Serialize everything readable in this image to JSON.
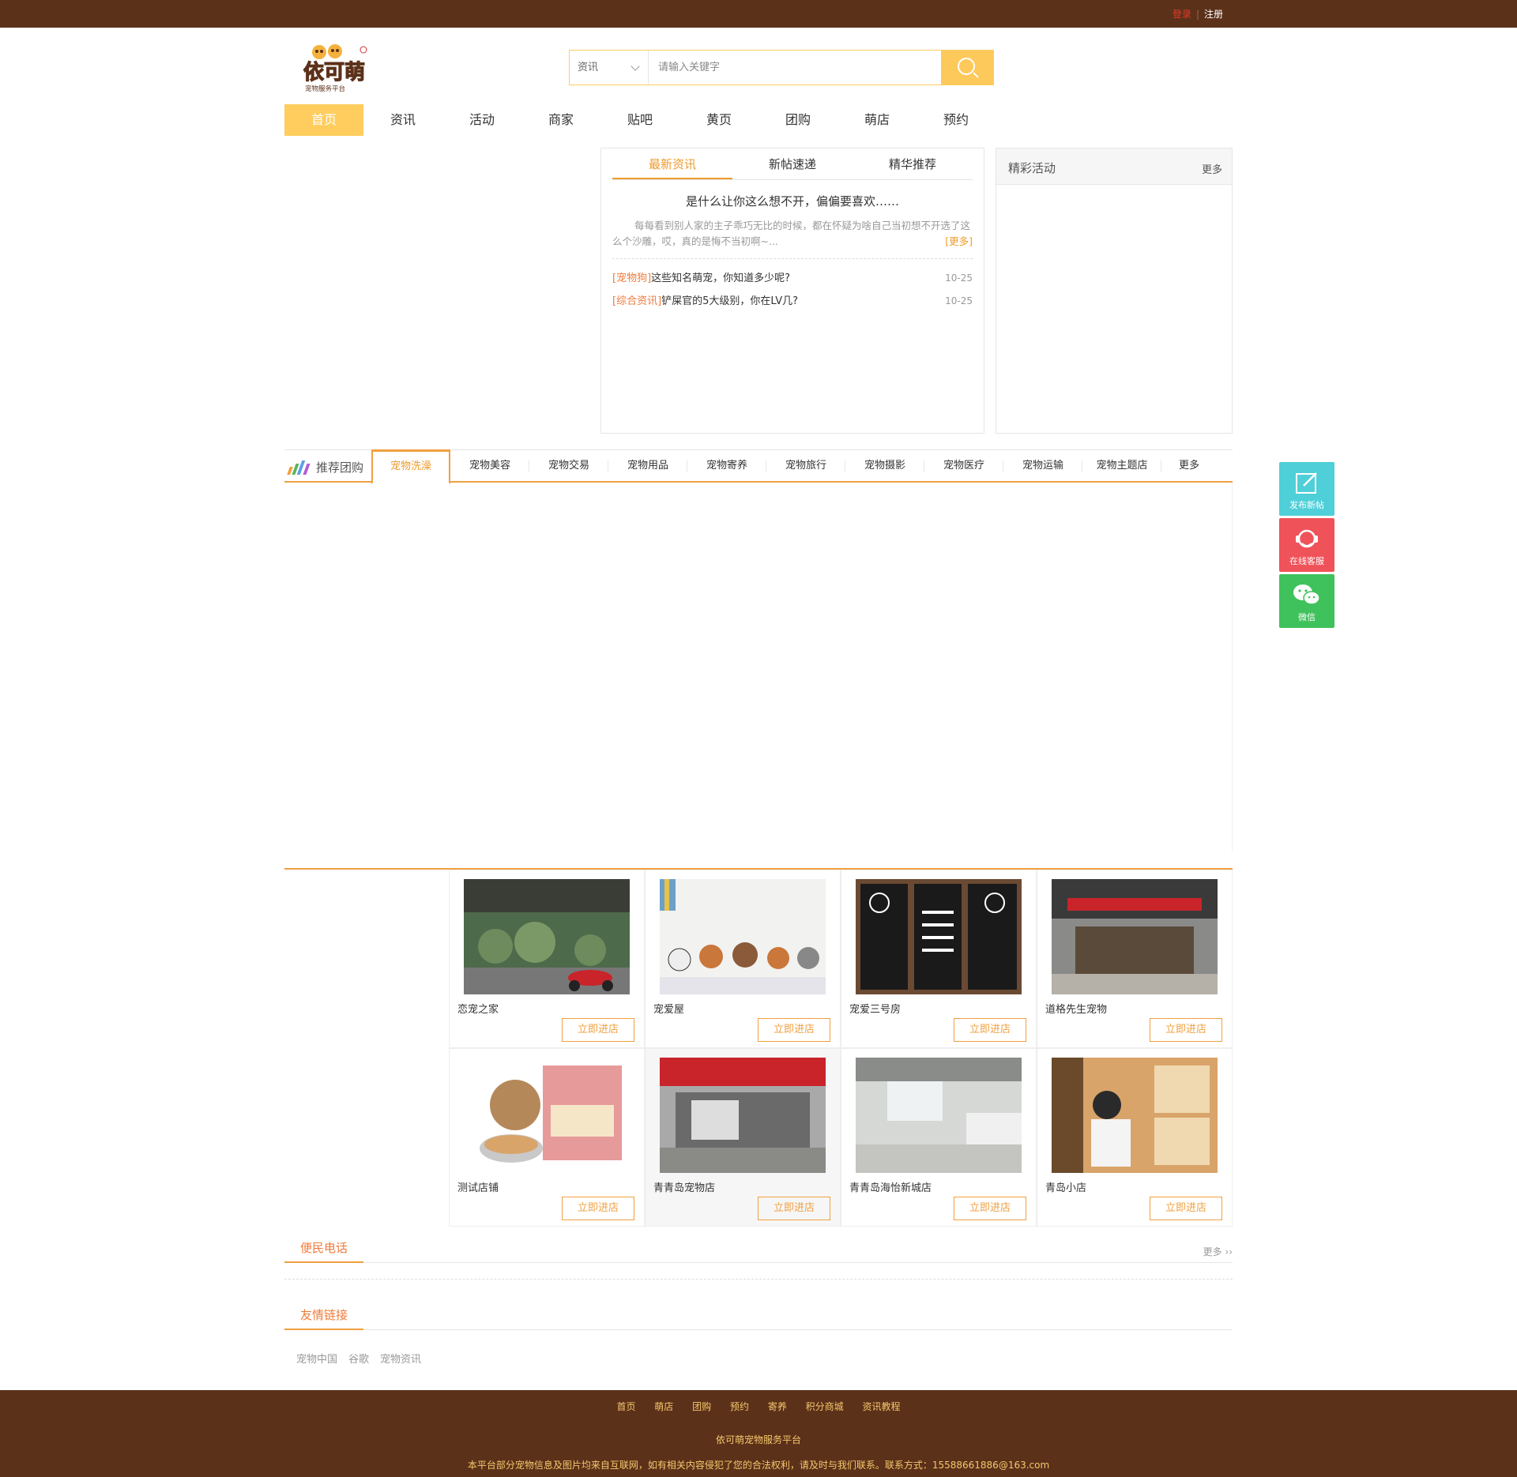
{
  "topbar": {
    "login": "登录",
    "register": "注册"
  },
  "header": {
    "logo_text": "依可萌",
    "logo_sub": "宠物服务平台",
    "search_category": "资讯",
    "search_placeholder": "请输入关键字"
  },
  "nav": [
    "首页",
    "资讯",
    "活动",
    "商家",
    "贴吧",
    "黄页",
    "团购",
    "萌店",
    "预约"
  ],
  "news": {
    "tabs": [
      "最新资讯",
      "新帖速递",
      "精华推荐"
    ],
    "headline": "是什么让你这么想不开，偏偏要喜欢……",
    "summary": "每每看到别人家的主子乖巧无比的时候，都在怀疑为啥自己当初想不开选了这么个沙雕，哎，真的是悔不当初啊~...",
    "more": "[更多]",
    "items": [
      {
        "tag": "[宠物狗]",
        "title": "这些知名萌宠，你知道多少呢?",
        "date": "10-25"
      },
      {
        "tag": "[综合资讯]",
        "title": "铲屎官的5大级别，你在LV几?",
        "date": "10-25"
      }
    ]
  },
  "activities": {
    "title": "精彩活动",
    "more": "更多"
  },
  "group": {
    "title": "推荐团购",
    "tabs": [
      "宠物洗澡",
      "宠物美容",
      "宠物交易",
      "宠物用品",
      "宠物寄养",
      "宠物旅行",
      "宠物摄影",
      "宠物医疗",
      "宠物运输",
      "宠物主题店",
      "更多"
    ]
  },
  "side": [
    "发布新帖",
    "在线客服",
    "微信"
  ],
  "shops": {
    "button": "立即进店",
    "items": [
      "恋宠之家",
      "宠爱屋",
      "宠爱三号房",
      "道格先生宠物",
      "测试店铺",
      "青青岛宠物店",
      "青青岛海怡新城店",
      "青岛小店"
    ]
  },
  "phone": {
    "title": "便民电话",
    "more": "更多 ››"
  },
  "links": {
    "title": "友情链接",
    "items": [
      "宠物中国",
      "谷歌",
      "宠物资讯"
    ]
  },
  "footer": {
    "nav": [
      "首页",
      "萌店",
      "团购",
      "预约",
      "寄养",
      "积分商城",
      "资讯教程"
    ],
    "name": "依可萌宠物服务平台",
    "copy": "本平台部分宠物信息及图片均来自互联网，如有相关内容侵犯了您的合法权利，请及时与我们联系。联系方式：15588661886@163.com"
  },
  "colors": {
    "brown": "#5c311a",
    "accent": "#f0a040",
    "yellow": "#ffcd5e"
  }
}
